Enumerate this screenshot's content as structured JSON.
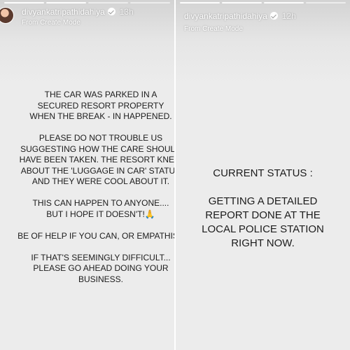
{
  "left_story": {
    "username": "divyankatripathidahiya",
    "time": "13h",
    "subtitle": "From Create Mode",
    "text": "THE CAR WAS PARKED IN A\nSECURED RESORT PROPERTY\nWHEN THE BREAK - IN HAPPENED.\n\nPLEASE DO NOT TROUBLE US\nSUGGESTING HOW THE CARE SHOULD\nHAVE BEEN TAKEN. THE RESORT KNEW\nABOUT THE 'LUGGAGE IN CAR' STATUS\nAND THEY WERE COOL ABOUT IT.\n\nTHIS CAN HAPPEN TO ANYONE....\nBUT I HOPE IT DOESN'T!🙏\n\nBE OF HELP IF YOU CAN, OR EMPATHISE\n\nIF THAT'S SEEMINGLY DIFFICULT...\nPLEASE GO AHEAD DOING YOUR\nBUSINESS."
  },
  "right_story": {
    "username": "divyankatripathidahiya",
    "time": "12h",
    "subtitle": "From Create Mode",
    "text": "CURRENT STATUS :\n\nGETTING A DETAILED\nREPORT DONE AT THE\nLOCAL POLICE STATION\nRIGHT NOW."
  },
  "colors": {
    "background": "#ececec",
    "text": "#1c1c1c",
    "header_text": "#ffffff"
  }
}
